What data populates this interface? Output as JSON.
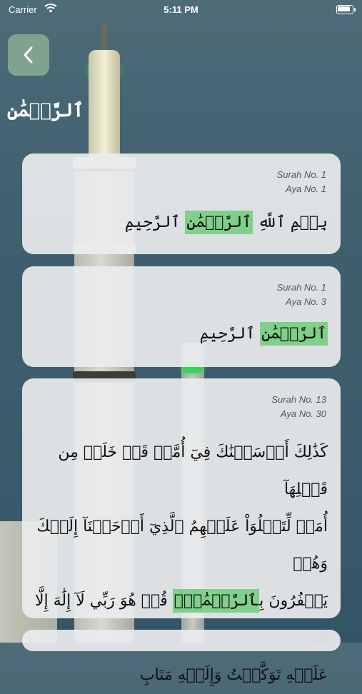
{
  "status_bar": {
    "carrier": "Carrier",
    "time": "5:11 PM"
  },
  "page": {
    "title": "ٱلرَّحۡمَٰنِ"
  },
  "results": [
    {
      "surah": "Surah No. 1",
      "aya": "Aya No. 1",
      "before": "بِسۡمِ ٱللَّهِ ",
      "highlight": "ٱلرَّحۡمَٰنِ",
      "after": " ٱلرَّحِيمِ"
    },
    {
      "surah": "Surah No. 1",
      "aya": "Aya No. 3",
      "before": "",
      "highlight": "ٱلرَّحۡمَٰنِ",
      "after": " ٱلرَّحِيمِ"
    },
    {
      "surah": "Surah No. 13",
      "aya": "Aya No. 30",
      "line1": "كَذَٰلِكَ أَرۡسَلۡنَٰكَ فِيٓ أُمَّةٖ قَدۡ خَلَتۡ مِن قَبۡلِهَآ",
      "line2": "أُمَمٞ لِّتَتۡلُوَاْ عَلَيۡهِمُ ٱلَّذِيٓ أَوۡحَيۡنَآ إِلَيۡكَ وَهُمۡ",
      "line3_before": "يَكۡفُرُونَ بِ",
      "line3_highlight": "ٱلرَّحۡمَٰنِۚ",
      "line3_after": " قُلۡ هُوَ رَبِّي لَآ إِلَٰهَ إِلَّا هُوَ",
      "line4": "عَلَيۡهِ تَوَكَّلۡتُ وَإِلَيۡهِ مَتَابِ"
    }
  ],
  "colors": {
    "highlight": "#7fd088",
    "back_button": "#8cb096"
  },
  "icons": {
    "back": "chevron-left-icon",
    "wifi": "wifi-icon",
    "battery": "battery-icon"
  }
}
